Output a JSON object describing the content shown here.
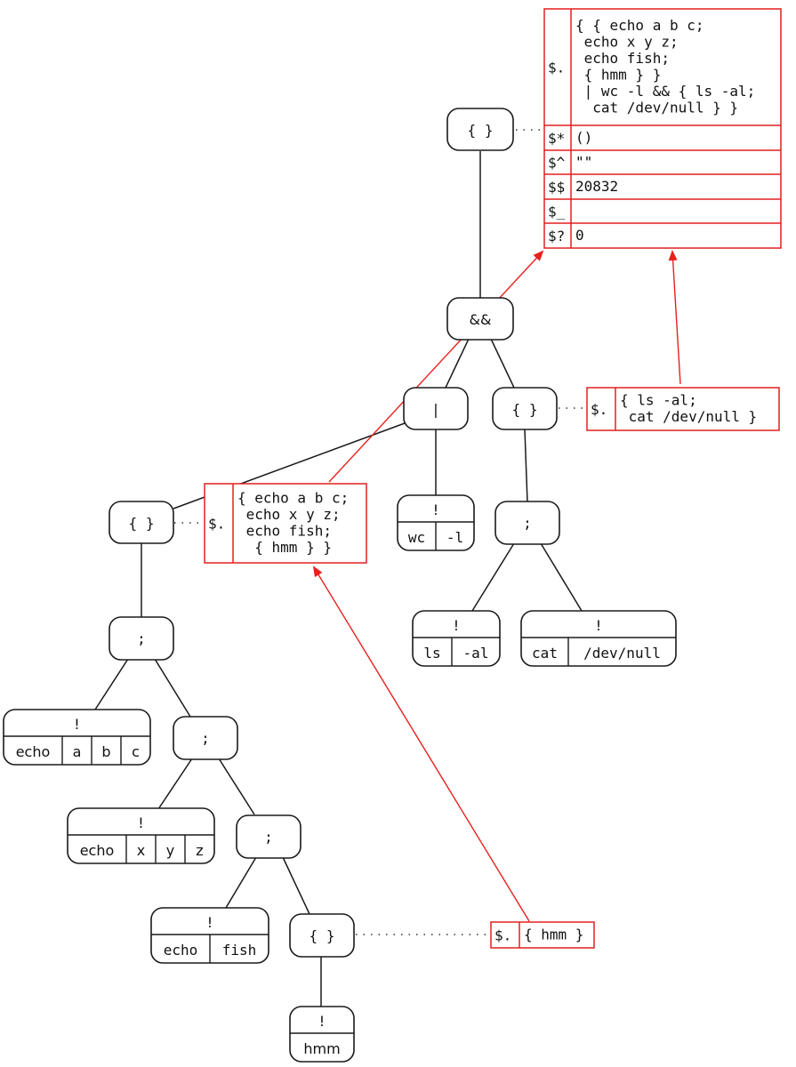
{
  "colors": {
    "tree_stroke": "#1a1a1a",
    "env_stroke": "#e0201e",
    "arrow": "#e8201c",
    "background": "#ffffff"
  },
  "tree": {
    "root_block": {
      "label": "{ }"
    },
    "and_op": {
      "label": "&&"
    },
    "pipe_op": {
      "label": "|"
    },
    "right_block": {
      "label": "{ }"
    },
    "left_block": {
      "label": "{ }"
    },
    "wc_cmd": {
      "bang": "!",
      "args": [
        "wc",
        "-l"
      ]
    },
    "right_seq": {
      "label": ";"
    },
    "ls_cmd": {
      "bang": "!",
      "args": [
        "ls",
        "-al"
      ]
    },
    "cat_cmd": {
      "bang": "!",
      "args": [
        "cat",
        "/dev/null"
      ]
    },
    "seq1": {
      "label": ";"
    },
    "echo_abc_cmd": {
      "bang": "!",
      "args": [
        "echo",
        "a",
        "b",
        "c"
      ]
    },
    "seq2": {
      "label": ";"
    },
    "echo_xyz_cmd": {
      "bang": "!",
      "args": [
        "echo",
        "x",
        "y",
        "z"
      ]
    },
    "seq3": {
      "label": ";"
    },
    "echo_fish_cmd": {
      "bang": "!",
      "args": [
        "echo",
        "fish"
      ]
    },
    "inner_block": {
      "label": "{ }"
    },
    "hmm_cmd": {
      "bang": "!",
      "args": [
        "hmm"
      ]
    }
  },
  "env_tables": {
    "root": {
      "rows": [
        {
          "key": "$.",
          "lines": [
            "{ { echo a b c;",
            " echo x y z;",
            " echo fish;",
            " { hmm } }",
            " | wc -l && { ls -al;",
            "  cat /dev/null } }"
          ]
        },
        {
          "key": "$*",
          "lines": [
            "()"
          ]
        },
        {
          "key": "$^",
          "lines": [
            "\"\""
          ]
        },
        {
          "key": "$$",
          "lines": [
            "20832"
          ]
        },
        {
          "key": "$_",
          "lines": [
            ""
          ]
        },
        {
          "key": "$?",
          "lines": [
            "0"
          ]
        }
      ]
    },
    "right_block": {
      "rows": [
        {
          "key": "$.",
          "lines": [
            "{ ls -al;",
            " cat /dev/null }"
          ]
        }
      ]
    },
    "left_block": {
      "rows": [
        {
          "key": "$.",
          "lines": [
            "{ echo a b c;",
            " echo x y z;",
            " echo fish;",
            "  { hmm } }"
          ]
        }
      ]
    },
    "inner_block": {
      "rows": [
        {
          "key": "$.",
          "lines": [
            "{ hmm }"
          ]
        }
      ]
    }
  }
}
